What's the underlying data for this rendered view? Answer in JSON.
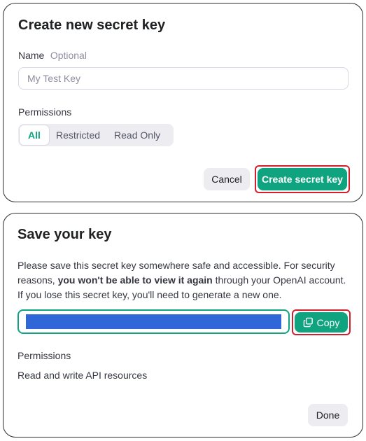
{
  "create_dialog": {
    "title": "Create new secret key",
    "name_label": "Name",
    "name_optional": "Optional",
    "name_placeholder": "My Test Key",
    "permissions_label": "Permissions",
    "permission_options": [
      "All",
      "Restricted",
      "Read Only"
    ],
    "selected_permission": "All",
    "cancel_label": "Cancel",
    "create_label": "Create secret key"
  },
  "save_dialog": {
    "title": "Save your key",
    "desc_part1": "Please save this secret key somewhere safe and accessible. For security reasons, ",
    "desc_bold": "you won't be able to view it again",
    "desc_part2": " through your OpenAI account. If you lose this secret key, you'll need to generate a new one.",
    "copy_label": "Copy",
    "permissions_label": "Permissions",
    "permissions_value": "Read and write API resources",
    "done_label": "Done"
  },
  "colors": {
    "accent": "#10a37f",
    "highlight_outline": "#d0202e",
    "redaction": "#2f67d8"
  }
}
